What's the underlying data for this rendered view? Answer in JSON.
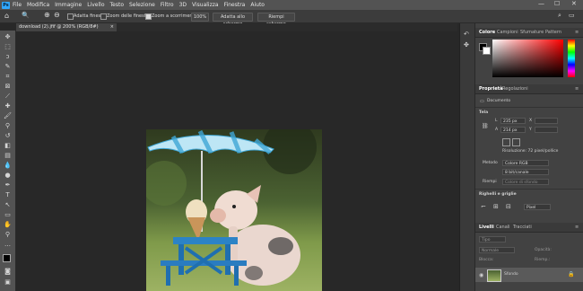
{
  "app": {
    "logo": "Ps"
  },
  "menu": [
    "File",
    "Modifica",
    "Immagine",
    "Livello",
    "Testo",
    "Selezione",
    "Filtro",
    "3D",
    "Visualizza",
    "Finestra",
    "Aiuto"
  ],
  "window_controls": {
    "minimize": "—",
    "maximize": "☐",
    "close": "✕"
  },
  "options_bar": {
    "zoom_pct": "Q",
    "adatta_finestra": "Adatta finestra",
    "zoom_tutte": "Zoom delle finestre",
    "zoom_scorrimento": "Zoom a scorrimento",
    "zoom_value": "100%",
    "adatta_schermo": "Adatta allo schermo",
    "riempi_schermo": "Riempi schermo"
  },
  "document_tab": {
    "title": "download (2).jfif @ 200% (RGB/8#)",
    "close": "×"
  },
  "panels": {
    "color": {
      "tabs": [
        "Colore",
        "Campioni",
        "Sfumature",
        "Pattern"
      ]
    },
    "properties": {
      "tabs": [
        "Proprietà",
        "Regolazioni"
      ],
      "doc_label": "Documento",
      "section_tela": "Tela",
      "L_label": "L",
      "L_value": "235 px",
      "A_label": "A",
      "A_value": "214 px",
      "X_label": "X",
      "Y_label": "Y",
      "risoluzione": "Risoluzione: 72 pixel/pollice",
      "metodo_label": "Metodo",
      "metodo_value": "Colore RGB",
      "bit_value": "8 bit/canale",
      "riempi_label": "Riempi",
      "riempi_value": "Colore di sfondo",
      "section_righelli": "Righelli e griglie",
      "unit_value": "Pixel"
    },
    "layers": {
      "tabs": [
        "Livelli",
        "Canali",
        "Tracciati"
      ],
      "search_placeholder": "Tipo",
      "blend_mode": "Normale",
      "opacity_label": "Opacità:",
      "lock_label": "Blocca:",
      "fill_label": "Riemp.:",
      "layer_name": "Sfondo"
    }
  },
  "colors": {
    "accent": "#31a8ff"
  }
}
